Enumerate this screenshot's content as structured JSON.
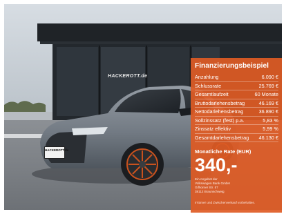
{
  "photo": {
    "sign_text": "HACKEROTT.de",
    "plate_text": "HACKEROTT.de"
  },
  "panel": {
    "title": "Finanzierungsbeispiel",
    "rows": [
      {
        "label": "Anzahlung",
        "value": "6.090 €"
      },
      {
        "label": "Schlussrate",
        "value": "25.769 €"
      },
      {
        "label": "Gesamtlaufzeit",
        "value": "60 Monate"
      },
      {
        "label": "Bruttodarlehensbetrag",
        "value": "46.169 €"
      },
      {
        "label": "Nettodarlehensbetrag",
        "value": "36.890 €"
      },
      {
        "label": "Sollzinssatz (fest) p.a.",
        "value": "5,83 %"
      },
      {
        "label": "Zinssatz effektiv",
        "value": "5,99 %"
      },
      {
        "label": "Gesamtdarlehensbetrag",
        "value": "46.130 €"
      }
    ],
    "rate_label": "Monatliche Rate (EUR)",
    "rate_value": "340,-",
    "dealer_lines": [
      "Ein Angebot der",
      "Volkswagen Bank GmbH",
      "Gifhorner Str. 57",
      "38112 Braunschweig"
    ],
    "footnote": "Irrtümer und Zwischenverkauf vorbehalten."
  },
  "colors": {
    "panel": "#e05b24",
    "car_body": "#7c848d",
    "wheel_accent": "#c9521e"
  }
}
